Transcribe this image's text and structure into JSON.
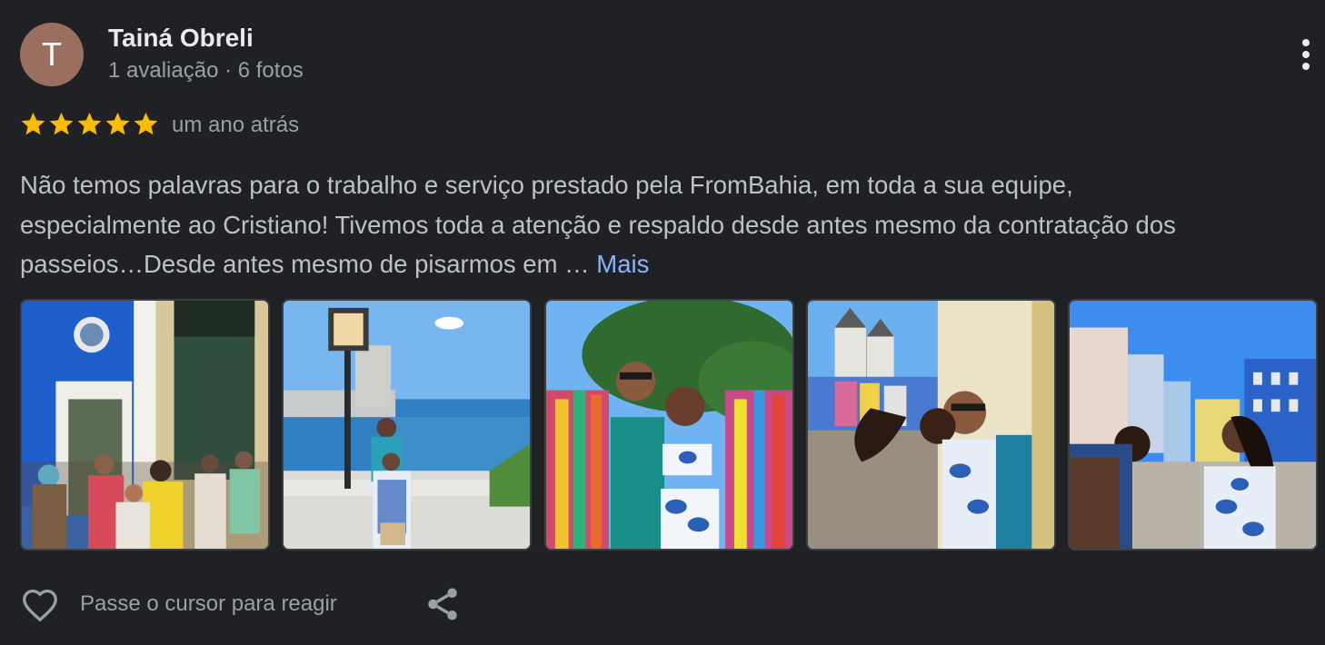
{
  "reviewer": {
    "initial": "T",
    "name": "Tainá Obreli",
    "meta": "1 avaliação · 6 fotos",
    "avatar_color": "#9a6f5f"
  },
  "rating": {
    "stars": 5,
    "max": 5,
    "time": "um ano atrás",
    "star_color": "#fbbc04"
  },
  "review": {
    "line1": "Não temos palavras para o trabalho e serviço prestado pela FromBahia, em toda a sua equipe,",
    "line2": "especialmente ao Cristiano! Tivemos toda a atenção e respaldo desde antes mesmo da contratação dos",
    "line3": "passeios…Desde antes mesmo de pisarmos em … ",
    "more_label": "Mais"
  },
  "photos": [
    {
      "icon": "photo-colonial-street-group"
    },
    {
      "icon": "photo-couple-lamp-post-bay"
    },
    {
      "icon": "photo-couple-ribbons"
    },
    {
      "icon": "photo-couple-church-kiss"
    },
    {
      "icon": "photo-body-painting-pelourinho"
    }
  ],
  "actions": {
    "react_label": "Passe o cursor para reagir",
    "heart_icon": "heart-outline-icon",
    "share_icon": "share-icon",
    "more_icon": "more-vert-icon"
  },
  "colors": {
    "background": "#202124",
    "text_primary": "#e8eaed",
    "text_secondary": "#9aa0a6",
    "link": "#8ab4f8"
  }
}
